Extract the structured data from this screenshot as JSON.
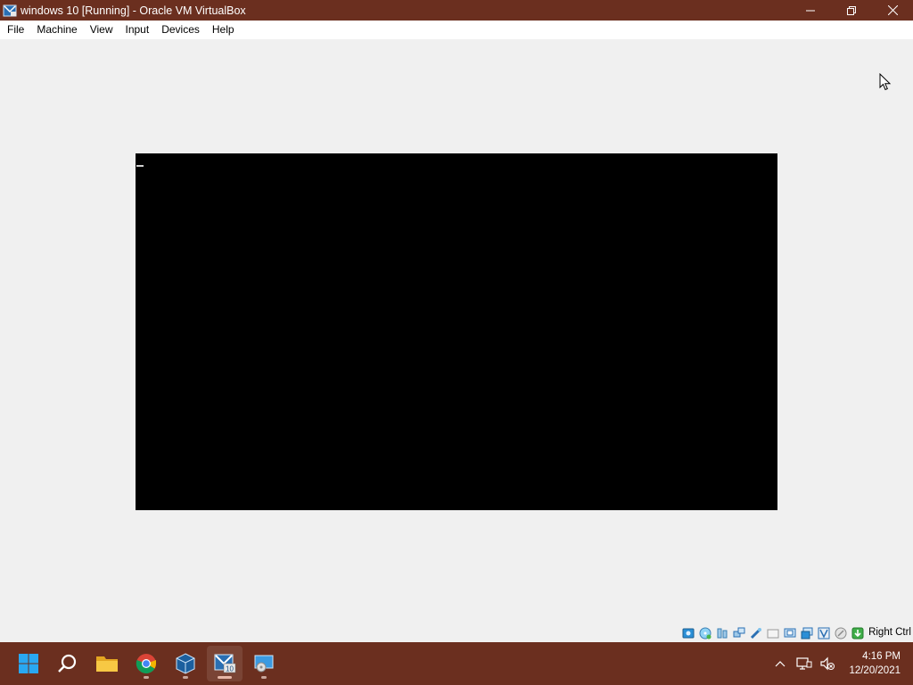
{
  "window": {
    "title": "windows 10 [Running] - Oracle VM VirtualBox"
  },
  "menu": {
    "items": [
      "File",
      "Machine",
      "View",
      "Input",
      "Devices",
      "Help"
    ]
  },
  "statusbar": {
    "icons": [
      "hard-disk-icon",
      "optical-drive-icon",
      "audio-icon",
      "network-icon",
      "usb-icon",
      "shared-folders-icon",
      "display-icon",
      "recording-icon",
      "vt-x-icon",
      "mouse-integration-icon",
      "keyboard-icon"
    ],
    "host_key": "Right Ctrl"
  },
  "taskbar": {
    "apps": [
      "start-icon",
      "search-icon",
      "file-explorer-icon",
      "chrome-icon",
      "virtualbox-manager-icon",
      "virtualbox-vm-icon",
      "remote-desktop-icon"
    ],
    "active_app": "virtualbox-vm-icon",
    "clock": {
      "time": "4:16 PM",
      "date": "12/20/2021"
    }
  },
  "colors": {
    "titlebar": "#6b2f1f",
    "taskbar": "#6b2f1f",
    "vm_background": "#f0f0f0",
    "vm_screen": "#000000"
  }
}
